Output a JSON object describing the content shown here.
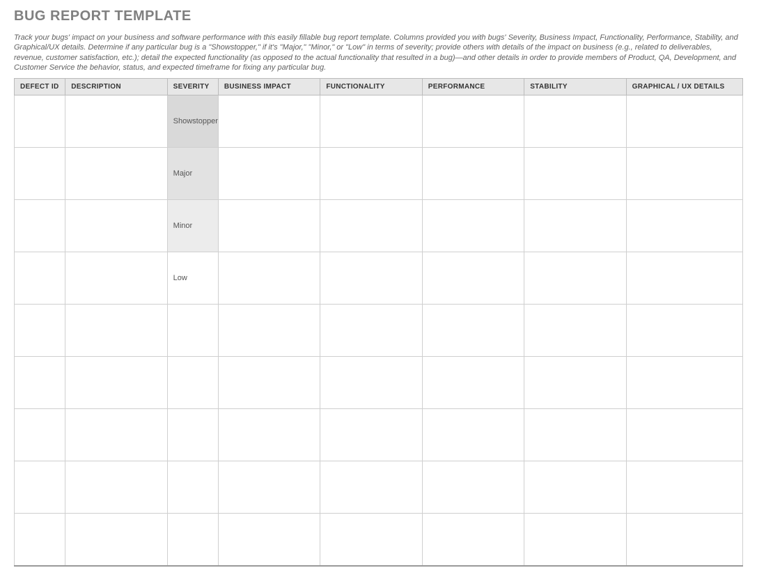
{
  "title": "BUG REPORT TEMPLATE",
  "description": "Track your bugs' impact on your business and software performance with this easily fillable bug report template. Columns provided you with bugs' Severity, Business Impact, Functionality, Performance, Stability, and Graphical/UX details. Determine if any particular bug is a \"Showstopper,\" if it's \"Major,\" \"Minor,\" or \"Low\" in terms of severity; provide others with details of the impact on business (e.g., related to deliverables, revenue, customer satisfaction, etc.); detail the expected functionality (as opposed to the actual functionality that resulted in a bug)—and other details in order to provide members of Product, QA, Development, and Customer Service the behavior, status, and expected timeframe for fixing any particular bug.",
  "columns": [
    "DEFECT ID",
    "DESCRIPTION",
    "SEVERITY",
    "BUSINESS IMPACT",
    "FUNCTIONALITY",
    "PERFORMANCE",
    "STABILITY",
    "GRAPHICAL / UX DETAILS"
  ],
  "rows": [
    {
      "defect_id": "",
      "description": "",
      "severity": "Showstopper",
      "severity_class": "sev-showstopper",
      "business_impact": "",
      "functionality": "",
      "performance": "",
      "stability": "",
      "ux": ""
    },
    {
      "defect_id": "",
      "description": "",
      "severity": "Major",
      "severity_class": "sev-major",
      "business_impact": "",
      "functionality": "",
      "performance": "",
      "stability": "",
      "ux": ""
    },
    {
      "defect_id": "",
      "description": "",
      "severity": "Minor",
      "severity_class": "sev-minor",
      "business_impact": "",
      "functionality": "",
      "performance": "",
      "stability": "",
      "ux": ""
    },
    {
      "defect_id": "",
      "description": "",
      "severity": "Low",
      "severity_class": "sev-low",
      "business_impact": "",
      "functionality": "",
      "performance": "",
      "stability": "",
      "ux": ""
    },
    {
      "defect_id": "",
      "description": "",
      "severity": "",
      "severity_class": "",
      "business_impact": "",
      "functionality": "",
      "performance": "",
      "stability": "",
      "ux": ""
    },
    {
      "defect_id": "",
      "description": "",
      "severity": "",
      "severity_class": "",
      "business_impact": "",
      "functionality": "",
      "performance": "",
      "stability": "",
      "ux": ""
    },
    {
      "defect_id": "",
      "description": "",
      "severity": "",
      "severity_class": "",
      "business_impact": "",
      "functionality": "",
      "performance": "",
      "stability": "",
      "ux": ""
    },
    {
      "defect_id": "",
      "description": "",
      "severity": "",
      "severity_class": "",
      "business_impact": "",
      "functionality": "",
      "performance": "",
      "stability": "",
      "ux": ""
    },
    {
      "defect_id": "",
      "description": "",
      "severity": "",
      "severity_class": "",
      "business_impact": "",
      "functionality": "",
      "performance": "",
      "stability": "",
      "ux": ""
    }
  ]
}
